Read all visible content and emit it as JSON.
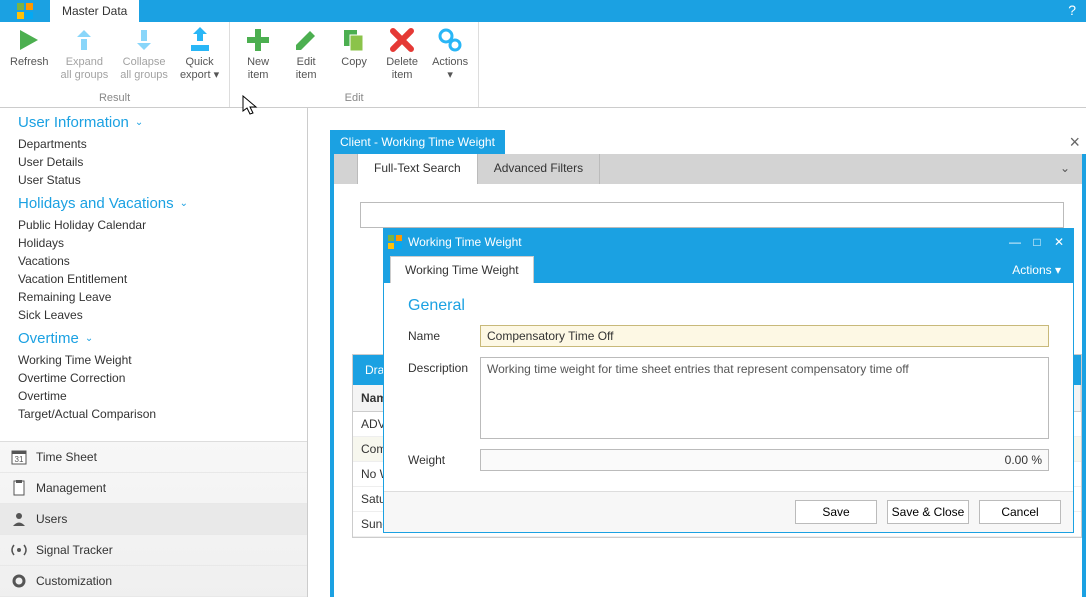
{
  "app": {
    "tab": "Master Data"
  },
  "ribbon": {
    "groups": [
      {
        "label": "Result",
        "items": [
          {
            "name": "refresh-button",
            "line1": "Refresh",
            "line2": "",
            "enabled": true,
            "icon": "play-green"
          },
          {
            "name": "expand-groups-button",
            "line1": "Expand",
            "line2": "all groups",
            "enabled": false,
            "icon": "expand"
          },
          {
            "name": "collapse-groups-button",
            "line1": "Collapse",
            "line2": "all groups",
            "enabled": false,
            "icon": "collapse"
          },
          {
            "name": "quick-export-button",
            "line1": "Quick",
            "line2": "export ▾",
            "enabled": true,
            "icon": "export"
          }
        ]
      },
      {
        "label": "Edit",
        "items": [
          {
            "name": "new-item-button",
            "line1": "New",
            "line2": "item",
            "enabled": true,
            "icon": "plus-green"
          },
          {
            "name": "edit-item-button",
            "line1": "Edit",
            "line2": "item",
            "enabled": true,
            "icon": "pencil-green"
          },
          {
            "name": "copy-button",
            "line1": "Copy",
            "line2": "",
            "enabled": true,
            "icon": "copy-green"
          },
          {
            "name": "delete-item-button",
            "line1": "Delete",
            "line2": "item",
            "enabled": true,
            "icon": "x-red"
          },
          {
            "name": "actions-button",
            "line1": "Actions",
            "line2": "▾",
            "enabled": true,
            "icon": "gears"
          }
        ]
      }
    ]
  },
  "sidebar": {
    "groups": [
      {
        "title": "User Information",
        "name": "group-user-info",
        "firstCut": true,
        "items": [
          "Departments",
          "User Details",
          "User Status"
        ]
      },
      {
        "title": "Holidays and Vacations",
        "name": "group-holidays",
        "items": [
          "Public Holiday Calendar",
          "Holidays",
          "Vacations",
          "Vacation Entitlement",
          "Remaining Leave",
          "Sick Leaves"
        ]
      },
      {
        "title": "Overtime",
        "name": "group-overtime",
        "items": [
          "Working Time Weight",
          "Overtime Correction",
          "Overtime",
          "Target/Actual Comparison"
        ]
      }
    ],
    "bottom": [
      {
        "name": "nav-time-sheet",
        "label": "Time Sheet",
        "icon": "calendar",
        "selected": false
      },
      {
        "name": "nav-management",
        "label": "Management",
        "icon": "clipboard",
        "selected": false
      },
      {
        "name": "nav-users",
        "label": "Users",
        "icon": "users",
        "selected": true
      },
      {
        "name": "nav-signal-tracker",
        "label": "Signal Tracker",
        "icon": "signal",
        "selected": false
      },
      {
        "name": "nav-customization",
        "label": "Customization",
        "icon": "gear",
        "selected": false
      }
    ]
  },
  "pane": {
    "title": "Client - Working Time Weight",
    "filters": {
      "tab1": "Full-Text Search",
      "tab2": "Advanced Filters"
    },
    "grid": {
      "groupHeader": "Drag",
      "col": "Name",
      "rows": [
        {
          "name": "ADV",
          "sel": false,
          "new": false
        },
        {
          "name": "Compe",
          "sel": true,
          "new": true
        },
        {
          "name": "No Wo",
          "sel": false,
          "new": false
        },
        {
          "name": "Saturd",
          "sel": false,
          "new": false
        },
        {
          "name": "Sunda",
          "sel": false,
          "new": false
        }
      ]
    }
  },
  "dialog": {
    "title": "Working Time Weight",
    "tab": "Working Time Weight",
    "actions": "Actions ▾",
    "section": "General",
    "labels": {
      "name": "Name",
      "description": "Description",
      "weight": "Weight"
    },
    "values": {
      "name": "Compensatory Time Off",
      "description": "Working time weight for time sheet entries that represent compensatory time off",
      "weight": "0.00 %"
    },
    "buttons": {
      "save": "Save",
      "saveClose": "Save & Close",
      "cancel": "Cancel"
    }
  }
}
